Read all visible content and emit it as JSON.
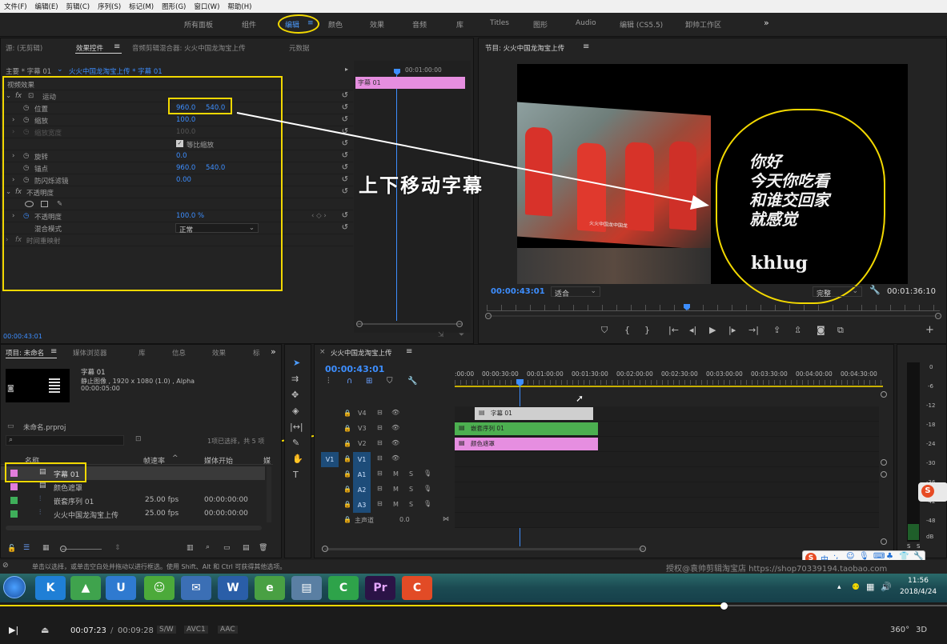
{
  "menu": [
    "文件(F)",
    "编辑(E)",
    "剪辑(C)",
    "序列(S)",
    "标记(M)",
    "图形(G)",
    "窗口(W)",
    "帮助(H)"
  ],
  "workspaces": [
    {
      "label": "所有面板"
    },
    {
      "label": "组件"
    },
    {
      "label": "编辑"
    },
    {
      "label": "颜色"
    },
    {
      "label": "效果"
    },
    {
      "label": "音频"
    },
    {
      "label": "库"
    },
    {
      "label": "Titles"
    },
    {
      "label": "图形"
    },
    {
      "label": "Audio"
    },
    {
      "label": "编辑 (CS5.5)"
    },
    {
      "label": "卸帅工作区"
    }
  ],
  "workspaces_more": "»",
  "effect_controls": {
    "tabs": [
      "源: (无剪辑)",
      "效果控件",
      "音频剪辑混合器: 火火中国龙淘宝上传",
      "元数据"
    ],
    "header": "主要 * 字幕 01",
    "header_seq": "火火中国龙淘宝上传 * 字幕 01",
    "clip_label": "字幕 01",
    "timecode_ruler": "00:01:00:00",
    "section_video": "视频效果",
    "motion": "运动",
    "position": {
      "label": "位置",
      "x": "960.0",
      "y": "540.0"
    },
    "scale": {
      "label": "缩放",
      "value": "100.0"
    },
    "scale_width": {
      "label": "缩放宽度",
      "value": "100.0"
    },
    "uniform_scale": "等比缩放",
    "rotation": {
      "label": "旋转",
      "value": "0.0"
    },
    "anchor": {
      "label": "锚点",
      "x": "960.0",
      "y": "540.0"
    },
    "anti_flicker": {
      "label": "防闪烁滤镜",
      "value": "0.00"
    },
    "opacity_section": "不透明度",
    "opacity": {
      "label": "不透明度",
      "value": "100.0 %"
    },
    "blend_mode": {
      "label": "混合模式",
      "value": "正常"
    },
    "time_remap": "时间重映射",
    "current_time": "00:00:43:01"
  },
  "program": {
    "title": "节目: 火火中国龙淘宝上传",
    "timecode": "00:00:43:01",
    "fit": "适合",
    "quality": "完整",
    "duration": "00:01:36:10",
    "subtitle_lines": [
      "你好",
      "今天你吃看",
      "和谁交回家",
      "就感觉"
    ],
    "subtitle_name": "khlug",
    "video_caption": "火火中国龙中国龙"
  },
  "annotation": {
    "text": "上下移动字幕"
  },
  "project": {
    "tabs": [
      "项目: 未命名",
      "媒体浏览器",
      "库",
      "信息",
      "效果",
      "标"
    ],
    "clip_name": "字幕 01",
    "clip_type": "静止图像 , 1920 x 1080 (1.0) , Alpha",
    "clip_duration": "00:00:05:00",
    "proj_file": "未命名.prproj",
    "selection": "1项已选择，共 5 项",
    "columns": [
      "名称",
      "帧速率",
      "媒体开始",
      "媒"
    ],
    "items": [
      {
        "name": "字幕 01",
        "fps": "",
        "start": "",
        "color": "#e27ddc"
      },
      {
        "name": "颜色遮罩",
        "fps": "",
        "start": "",
        "color": "#e27ddc"
      },
      {
        "name": "嵌套序列 01",
        "fps": "25.00 fps",
        "start": "00:00:00:00",
        "color": "#3fae5a"
      },
      {
        "name": "火火中国龙淘宝上传",
        "fps": "25.00 fps",
        "start": "00:00:00:00",
        "color": "#3fae5a"
      }
    ]
  },
  "timeline": {
    "tab": "火火中国龙淘宝上传",
    "timecode": "00:00:43:01",
    "ruler": [
      ":00:00",
      "00:00:30:00",
      "00:01:00:00",
      "00:01:30:00",
      "00:02:00:00",
      "00:02:30:00",
      "00:03:00:00",
      "00:03:30:00",
      "00:04:00:00",
      "00:04:30:00"
    ],
    "tracks_video": [
      "V4",
      "V3",
      "V2",
      "V1"
    ],
    "tracks_audio": [
      "A1",
      "A2",
      "A3"
    ],
    "master": "主声道",
    "master_val": "0.0",
    "src_v": "V1",
    "clip_title": "字幕 01",
    "clip_nested": "嵌套序列 01",
    "clip_matte": "颜色遮罩",
    "track_btns": {
      "m": "M",
      "s": "S"
    }
  },
  "meter": [
    "0",
    "-6",
    "-12",
    "-18",
    "-24",
    "-30",
    "-36",
    "-42",
    "-48",
    "dB"
  ],
  "meter_solo": [
    "S",
    "S"
  ],
  "status_bar": "单击以选择，或单击空白处并拖动以进行框选。使用 Shift、Alt 和 Ctrl 可获得其他选项。",
  "watermark": "授权@袁帅剪辑淘宝店 https://shop70339194.taobao.com",
  "taskbar": {
    "time": "11:56",
    "date": "2018/4/24",
    "apps": [
      {
        "label": "K",
        "color": "#1f7fd6"
      },
      {
        "label": "▲",
        "color": "#3fa34d"
      },
      {
        "label": "U",
        "color": "#2f7ad0"
      },
      {
        "label": "☺",
        "color": "#4caa3a"
      },
      {
        "label": "✉",
        "color": "#3b6fb5"
      },
      {
        "label": "W",
        "color": "#2a5ea8"
      },
      {
        "label": "e",
        "color": "#49a043"
      },
      {
        "label": "▤",
        "color": "#5a7fa3"
      },
      {
        "label": "C",
        "color": "#2ea34a"
      },
      {
        "label": "Pr",
        "color": "#2b1346"
      },
      {
        "label": "C",
        "color": "#e24b26"
      }
    ]
  },
  "player": {
    "current": "00:07:23",
    "separator": "/",
    "total": "00:09:28",
    "tags": [
      "S/W",
      "AVC1",
      "AAC"
    ],
    "progress": 0.764,
    "icons": [
      "360°",
      "3D"
    ]
  },
  "ime": {
    "label": "中"
  }
}
